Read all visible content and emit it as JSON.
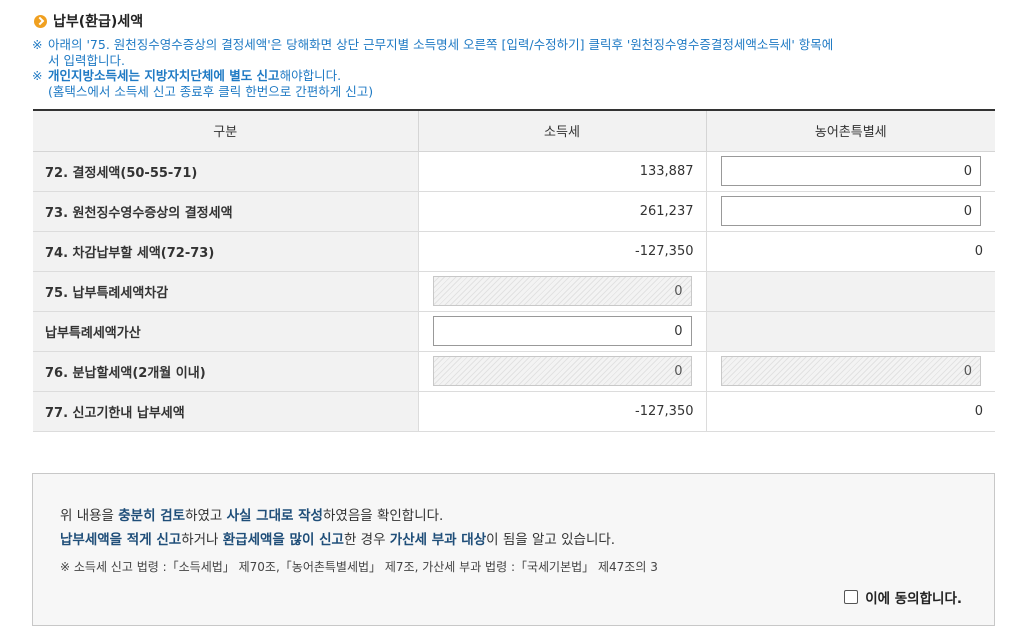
{
  "section": {
    "title": "납부(환급)세액",
    "icon": "chevron-circle-icon",
    "icon_color": "#f0a020"
  },
  "notes": [
    {
      "mark": "※",
      "lines": [
        "아래의 '75. 원천징수영수증상의 결정세액'은 당해화면 상단 근무지별 소득명세 오른쪽 [입력/수정하기] 클릭후 '원천징수영수증결정세액소득세' 항목에",
        "서 입력합니다."
      ]
    },
    {
      "mark": "※",
      "bold": "개인지방소득세는 지방자치단체에 별도 신고",
      "rest": "해야합니다.",
      "sub": "(홈택스에서 소득세 신고 종료후 클릭 한번으로 간편하게 신고)"
    }
  ],
  "table": {
    "headers": [
      "구분",
      "소득세",
      "농어촌특별세"
    ],
    "rows": [
      {
        "label": "72. 결정세액(50-55-71)",
        "income": "133,887",
        "rural": "0"
      },
      {
        "label": "73. 원천징수영수증상의 결정세액",
        "income": "261,237",
        "rural": "0"
      },
      {
        "label": "74. 차감납부할 세액(72-73)",
        "income": "-127,350",
        "rural": "0"
      },
      {
        "label": "75. 납부특례세액차감",
        "income": "0",
        "rural": ""
      },
      {
        "label": "납부특례세액가산",
        "income": "0",
        "rural": ""
      },
      {
        "label": "76. 분납할세액(2개월 이내)",
        "income": "0",
        "rural": "0"
      },
      {
        "label": "77. 신고기한내 납부세액",
        "income": "-127,350",
        "rural": "0"
      }
    ]
  },
  "consent": {
    "line1": [
      "위 내용을 ",
      "충분히 검토",
      "하였고 ",
      "사실 그대로 작성",
      "하였음을 확인합니다."
    ],
    "line2": [
      "납부세액을 적게 신고",
      "하거나 ",
      "환급세액을 많이 신고",
      "한 경우 ",
      "가산세 부과 대상",
      "이 됨을 알고 있습니다."
    ],
    "law_note": "※ 소득세 신고 법령 :「소득세법」 제70조,「농어촌특별세법」 제7조, 가산세 부과 법령 :「국세기본법」 제47조의 3",
    "agree_label": "이에 동의합니다.",
    "agree_checked": false
  },
  "colors": {
    "note_blue": "#1f7ac4",
    "emphasis_navy": "#1f4e79",
    "header_bg": "#f2f2f2"
  }
}
